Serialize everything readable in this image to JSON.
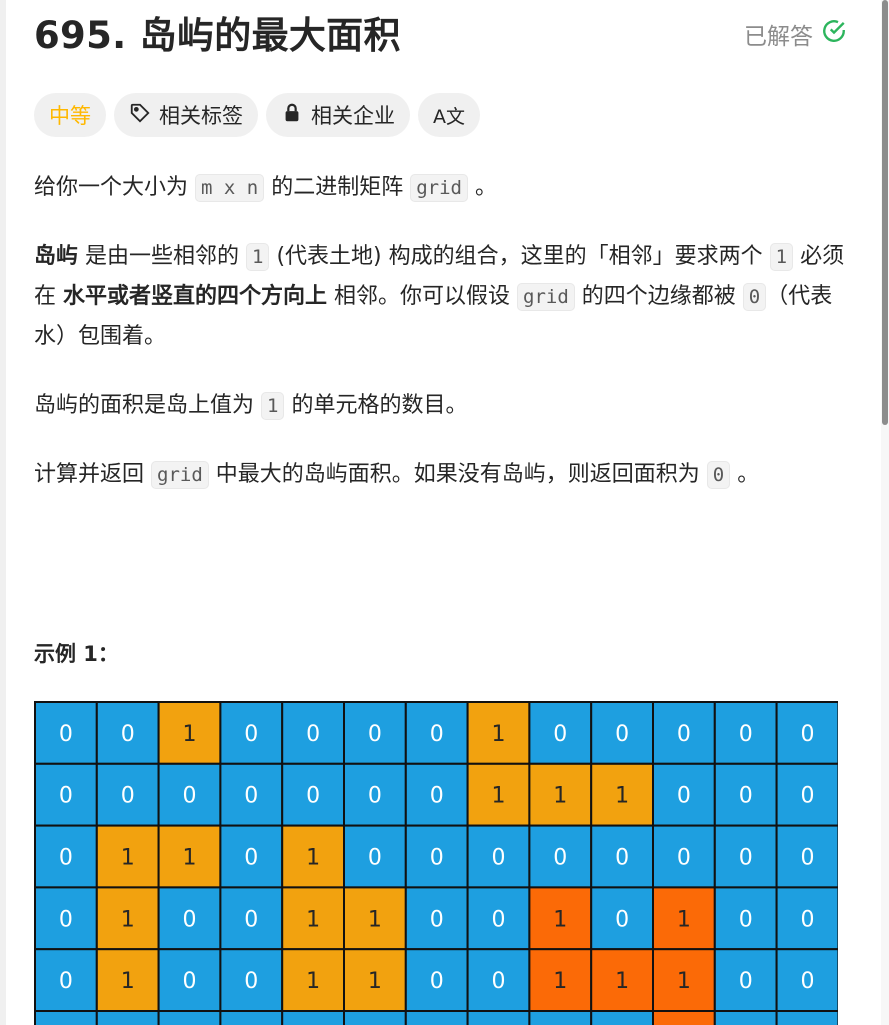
{
  "problem": {
    "title": "695. 岛屿的最大面积",
    "solved_label": "已解答"
  },
  "tags": {
    "difficulty": "中等",
    "related_tags": "相关标签",
    "related_companies": "相关企业",
    "translate": "A文"
  },
  "description": {
    "p1": [
      {
        "t": "给你一个大小为 "
      },
      {
        "t": "m x n",
        "code": true
      },
      {
        "t": " 的二进制矩阵 "
      },
      {
        "t": "grid",
        "code": true
      },
      {
        "t": " 。"
      }
    ],
    "p2": [
      {
        "t": "岛屿",
        "bold": true
      },
      {
        "t": " 是由一些相邻的 "
      },
      {
        "t": "1",
        "code": true
      },
      {
        "t": " (代表土地) 构成的组合，这里的「相邻」要求两个 "
      },
      {
        "t": "1",
        "code": true
      },
      {
        "t": " 必须在 "
      },
      {
        "t": "水平或者竖直的四个方向上",
        "bold": true
      },
      {
        "t": " 相邻。你可以假设 "
      },
      {
        "t": "grid",
        "code": true
      },
      {
        "t": " 的四个边缘都被 "
      },
      {
        "t": "0",
        "code": true
      },
      {
        "t": "（代表水）包围着。"
      }
    ],
    "p3": [
      {
        "t": "岛屿的面积是岛上值为 "
      },
      {
        "t": "1",
        "code": true
      },
      {
        "t": " 的单元格的数目。"
      }
    ],
    "p4": [
      {
        "t": "计算并返回 "
      },
      {
        "t": "grid",
        "code": true
      },
      {
        "t": " 中最大的岛屿面积。如果没有岛屿，则返回面积为 "
      },
      {
        "t": "0",
        "code": true
      },
      {
        "t": " 。"
      }
    ]
  },
  "example": {
    "title": "示例 1：",
    "grid": [
      [
        0,
        0,
        1,
        0,
        0,
        0,
        0,
        1,
        0,
        0,
        0,
        0,
        0
      ],
      [
        0,
        0,
        0,
        0,
        0,
        0,
        0,
        1,
        1,
        1,
        0,
        0,
        0
      ],
      [
        0,
        1,
        1,
        0,
        1,
        0,
        0,
        0,
        0,
        0,
        0,
        0,
        0
      ],
      [
        0,
        1,
        0,
        0,
        1,
        1,
        0,
        0,
        1,
        0,
        1,
        0,
        0
      ],
      [
        0,
        1,
        0,
        0,
        1,
        1,
        0,
        0,
        1,
        1,
        1,
        0,
        0
      ]
    ],
    "highlight_cells": [
      [
        3,
        8
      ],
      [
        3,
        10
      ],
      [
        4,
        8
      ],
      [
        4,
        9
      ],
      [
        4,
        10
      ]
    ],
    "colors": {
      "water": "#1e9fe0",
      "land": "#f2a20f",
      "largest_island": "#fb6a07",
      "grid_line": "#111111",
      "accent_difficulty": "#ffb800",
      "solved_check": "#2db55d"
    }
  }
}
